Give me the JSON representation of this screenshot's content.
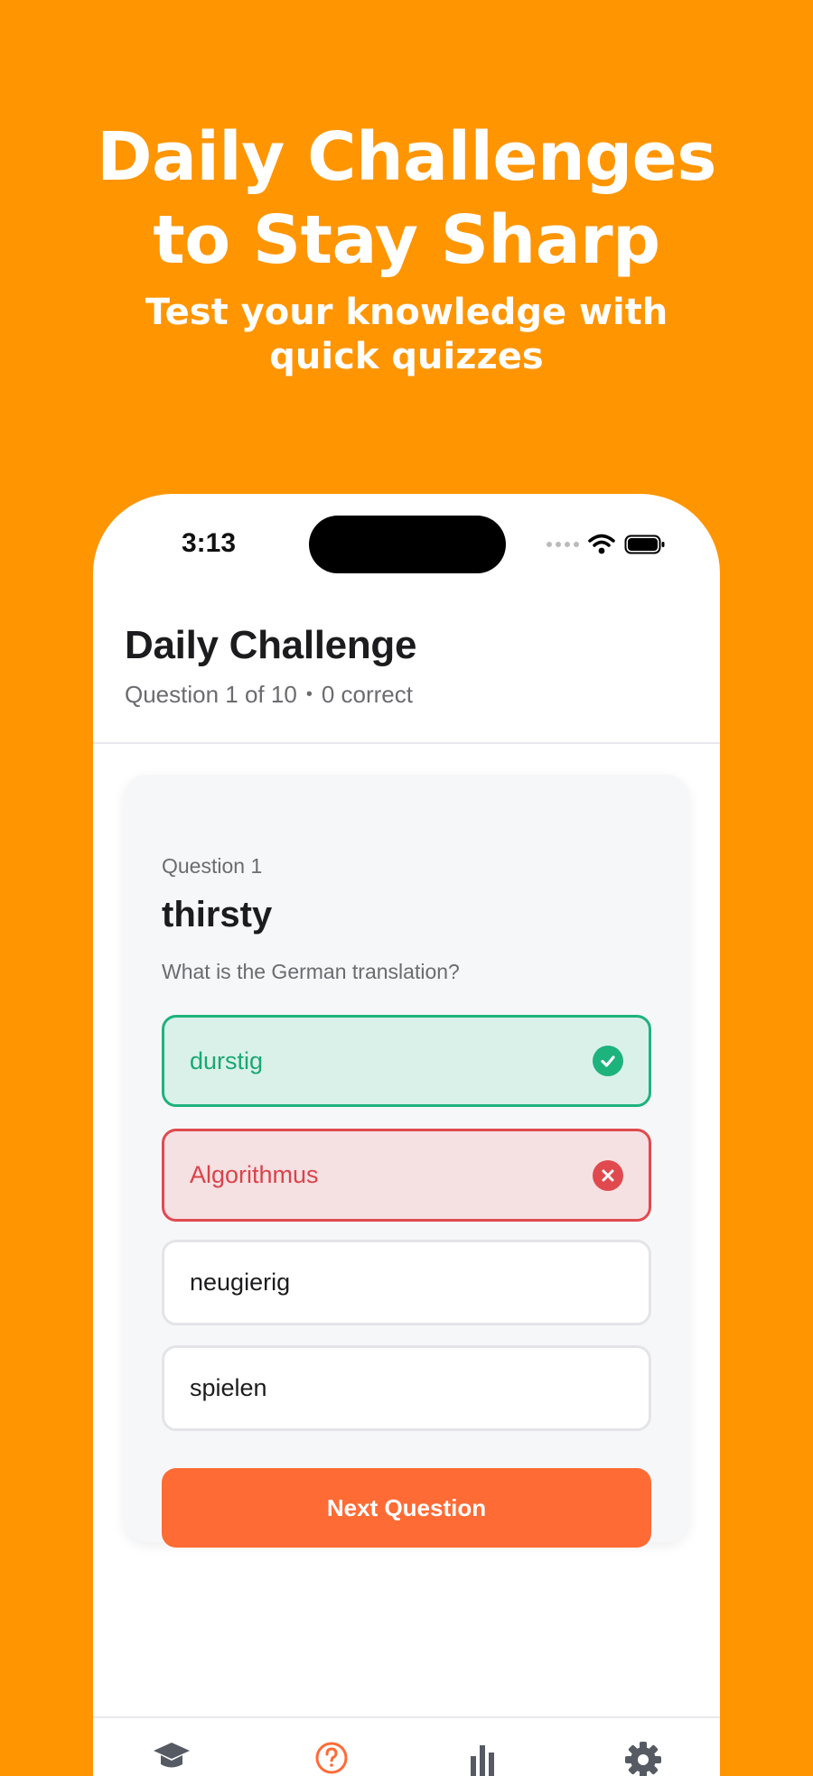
{
  "hero": {
    "title_line1": "Daily Challenges",
    "title_line2": "to Stay Sharp",
    "subtitle": "Test your knowledge with quick quizzes"
  },
  "status_bar": {
    "time": "3:13",
    "icons": [
      "signal-icon",
      "wifi-icon",
      "battery-icon"
    ]
  },
  "header": {
    "title": "Daily Challenge",
    "progress": "Question 1 of 10",
    "separator": "•",
    "correct": "0 correct"
  },
  "question": {
    "label": "Question 1",
    "word": "thirsty",
    "prompt": "What is the German translation?"
  },
  "options": [
    {
      "text": "durstig",
      "state": "correct"
    },
    {
      "text": "Algorithmus",
      "state": "wrong"
    },
    {
      "text": "neugierig",
      "state": "neutral"
    },
    {
      "text": "spielen",
      "state": "neutral"
    }
  ],
  "next_button": "Next Question",
  "tab_bar": {
    "icons": [
      "learn-icon",
      "quiz-icon",
      "stats-icon",
      "settings-icon"
    ],
    "active": "quiz-icon"
  },
  "colors": {
    "background": "#FF9500",
    "accent": "#FF6B35",
    "correct": "#1DB37D",
    "wrong": "#E04A4F"
  }
}
